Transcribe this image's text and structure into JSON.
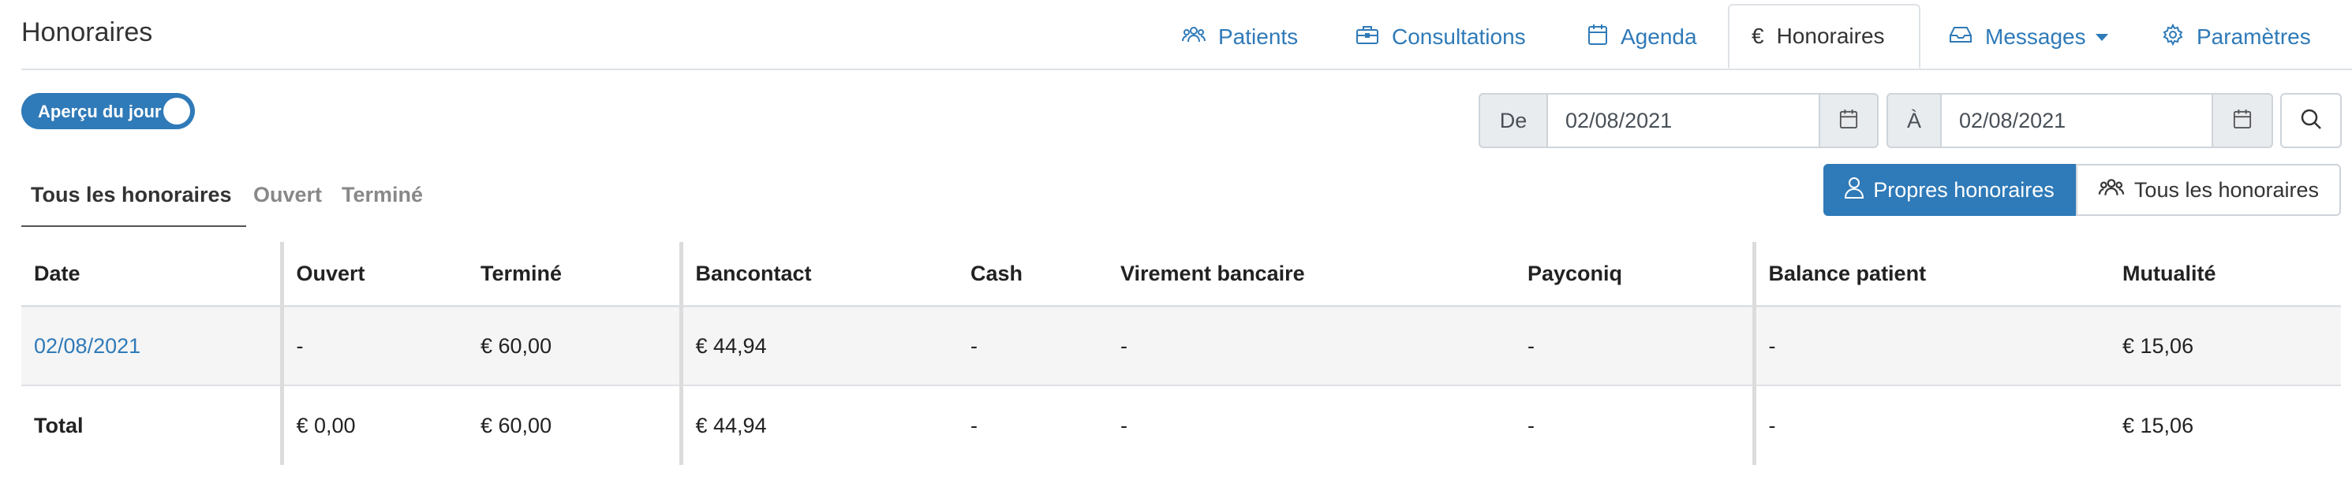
{
  "page": {
    "title": "Honoraires"
  },
  "tabs": [
    {
      "label": "Patients",
      "icon": "users-icon"
    },
    {
      "label": "Consultations",
      "icon": "briefcase-icon"
    },
    {
      "label": "Agenda",
      "icon": "calendar-icon"
    },
    {
      "label": "Honoraires",
      "icon": "euro-icon"
    },
    {
      "label": "Messages",
      "icon": "inbox-icon"
    },
    {
      "label": "Paramètres",
      "icon": "gear-icon"
    }
  ],
  "active_tab": "Honoraires",
  "toggle": {
    "label": "Aperçu du jour",
    "on": true
  },
  "filter": {
    "from_label": "De",
    "from_value": "02/08/2021",
    "to_label": "À",
    "to_value": "02/08/2021"
  },
  "subtabs": [
    "Tous les honoraires",
    "Ouvert",
    "Terminé"
  ],
  "scope_buttons": {
    "own": "Propres honoraires",
    "all": "Tous les honoraires"
  },
  "table": {
    "headers": [
      "Date",
      "Ouvert",
      "Terminé",
      "Bancontact",
      "Cash",
      "Virement bancaire",
      "Payconiq",
      "Balance patient",
      "Mutualité"
    ],
    "rows": [
      [
        "02/08/2021",
        "-",
        "€ 60,00",
        "€ 44,94",
        "-",
        "-",
        "-",
        "-",
        "€ 15,06"
      ]
    ],
    "total": [
      "Total",
      "€ 0,00",
      "€ 60,00",
      "€ 44,94",
      "-",
      "-",
      "-",
      "-",
      "€ 15,06"
    ]
  },
  "colors": {
    "accent": "#2f7ab8",
    "messages_icon": "#e0534a"
  }
}
